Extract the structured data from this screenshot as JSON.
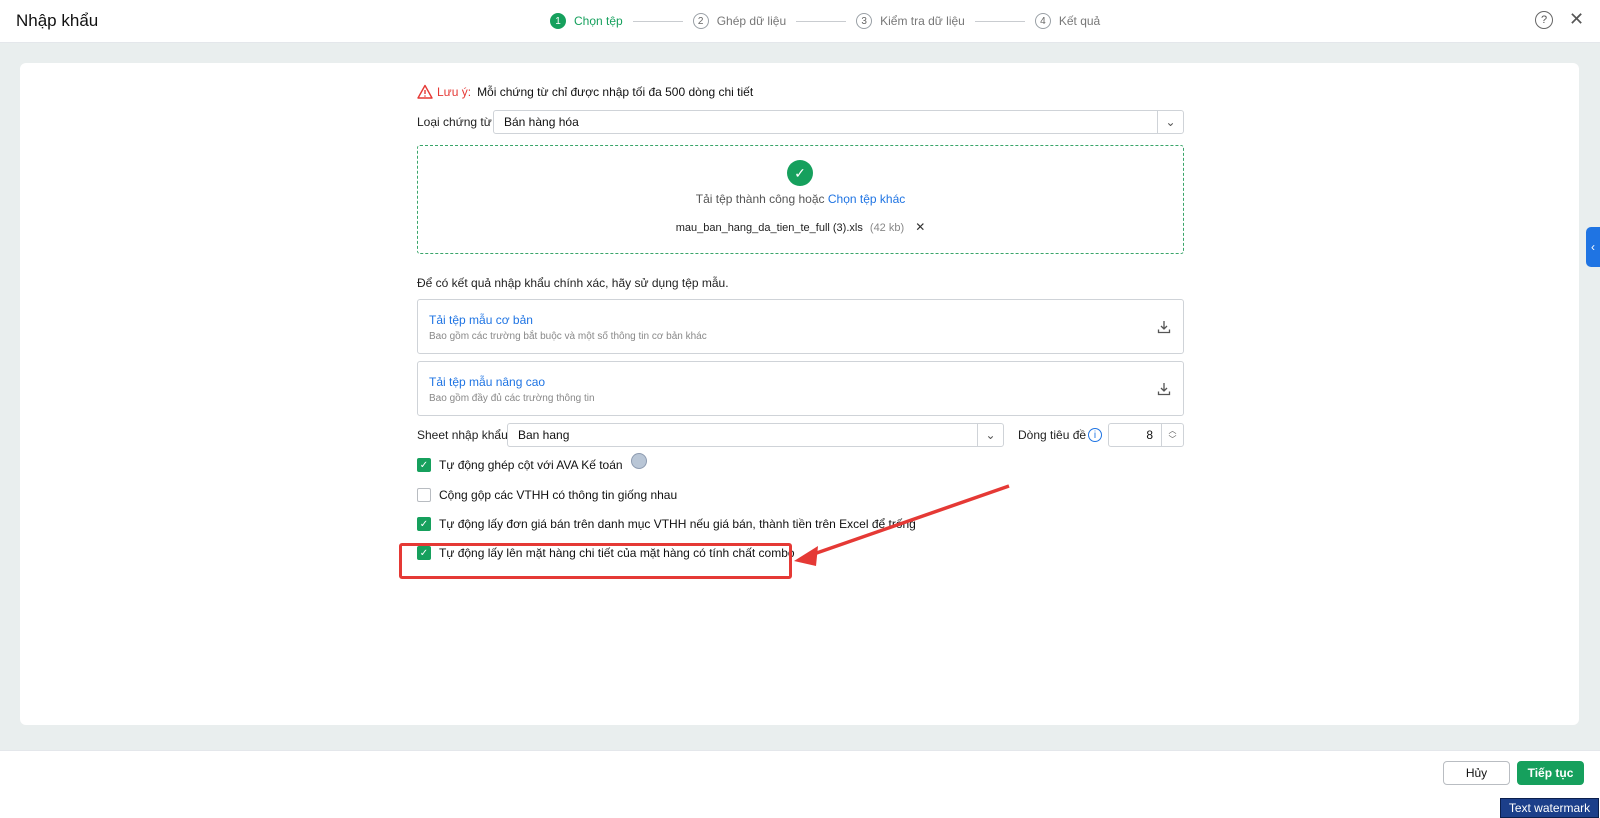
{
  "header": {
    "title": "Nhập khẩu",
    "steps": [
      {
        "num": "1",
        "label": "Chọn tệp"
      },
      {
        "num": "2",
        "label": "Ghép dữ liệu"
      },
      {
        "num": "3",
        "label": "Kiểm tra dữ liệu"
      },
      {
        "num": "4",
        "label": "Kết quả"
      }
    ],
    "help_glyph": "?",
    "close_glyph": "✕"
  },
  "note": {
    "label": "Lưu ý:",
    "text": "Mỗi chứng từ chỉ được nhập tối đa 500 dòng chi tiết"
  },
  "voucher": {
    "label": "Loại chứng từ",
    "value": "Bán hàng hóa"
  },
  "upload": {
    "success_text": "Tải tệp thành công hoặc",
    "choose_other": "Chọn tệp khác",
    "file_name": "mau_ban_hang_da_tien_te_full (3).xls",
    "file_size": "(42 kb)"
  },
  "hint": "Để có kết quả nhập khẩu chính xác, hãy sử dụng tệp mẫu.",
  "templates": [
    {
      "title": "Tải tệp mẫu cơ bản",
      "desc": "Bao gồm các trường bắt buộc và một số thông tin cơ bản khác"
    },
    {
      "title": "Tải tệp mẫu nâng cao",
      "desc": "Bao gồm đầy đủ các trường thông tin"
    }
  ],
  "sheet": {
    "label": "Sheet nhập khẩu",
    "value": "Ban hang",
    "header_row_label": "Dòng tiêu đề",
    "header_row_value": "8"
  },
  "options": [
    {
      "label": "Tự động ghép cột với AVA Kế toán",
      "checked": true
    },
    {
      "label": "Cộng gộp các VTHH có thông tin giống nhau",
      "checked": false
    },
    {
      "label": "Tự động lấy đơn giá bán trên danh mục VTHH nếu giá bán, thành tiền trên Excel để trống",
      "checked": true
    },
    {
      "label": "Tự động lấy lên mặt hàng chi tiết của mặt hàng có tính chất combo",
      "checked": true
    }
  ],
  "footer": {
    "cancel": "Hủy",
    "next": "Tiếp tục"
  },
  "watermark": "Text watermark",
  "colors": {
    "accent": "#16a05d",
    "link": "#1f74e3",
    "warning": "#e53935"
  }
}
